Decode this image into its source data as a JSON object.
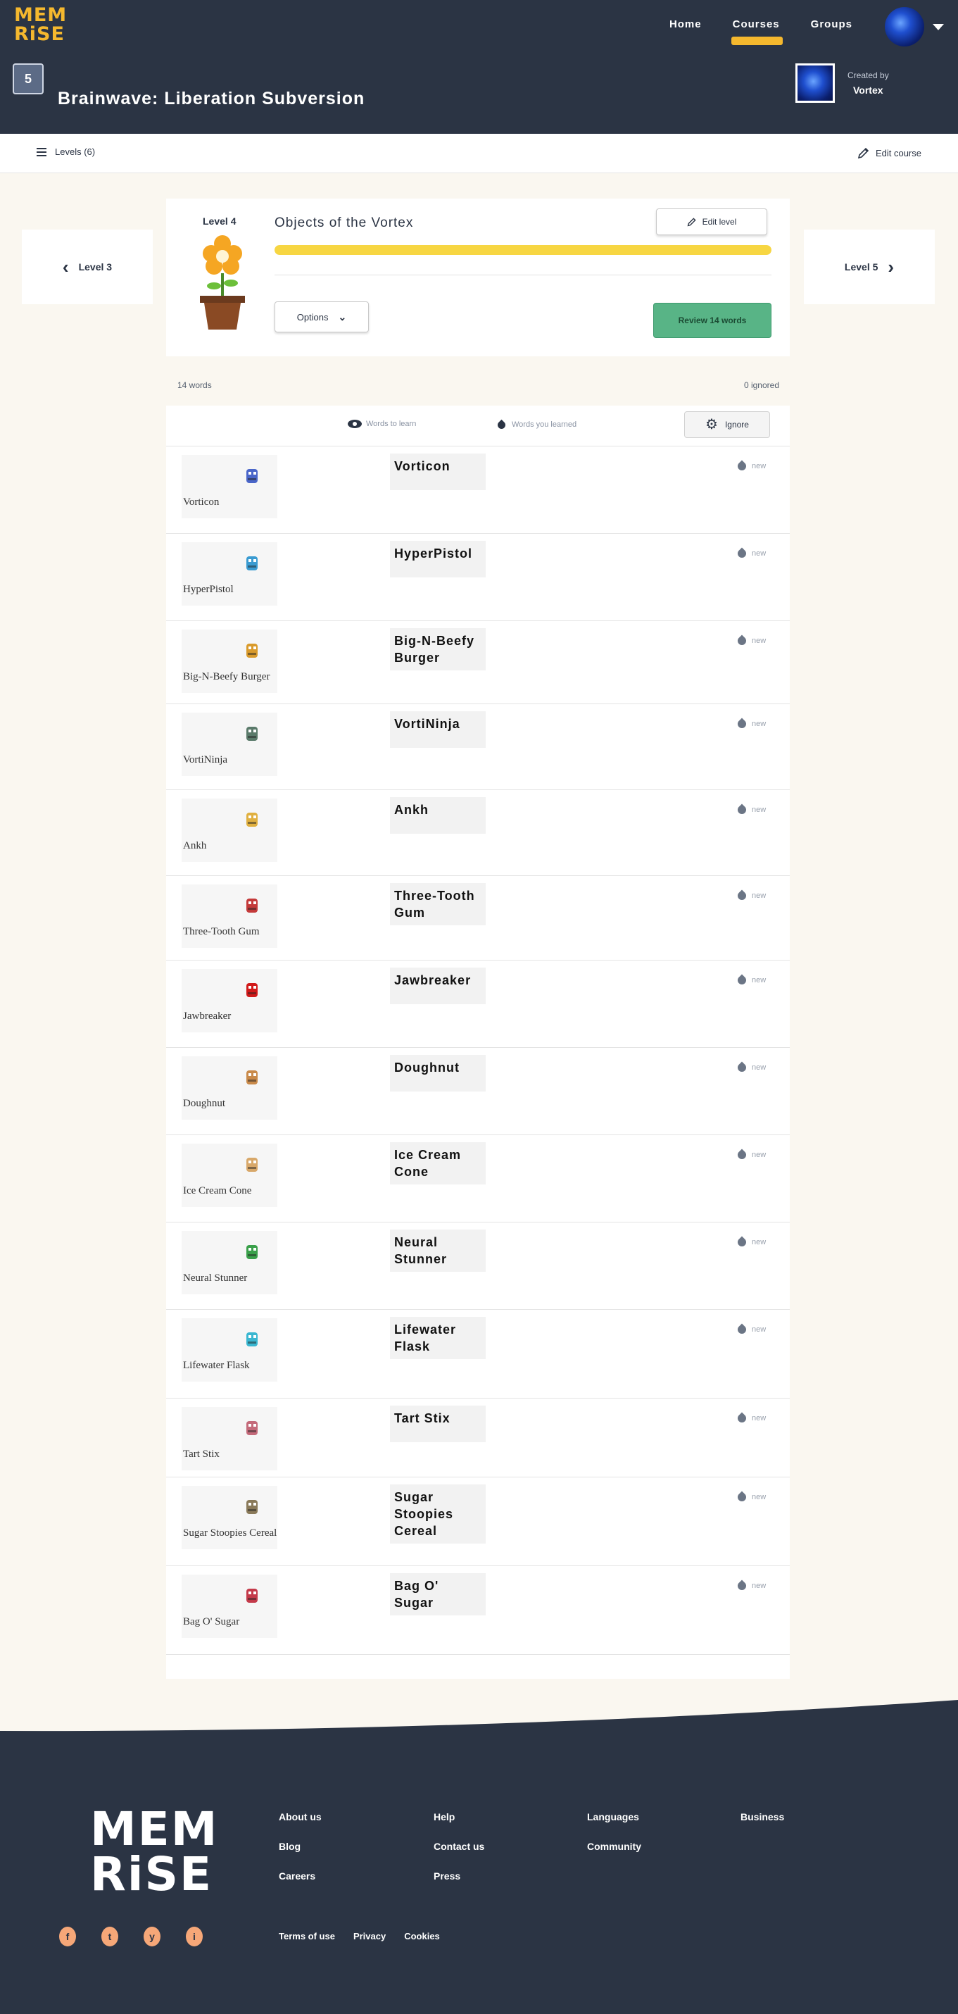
{
  "header": {
    "logo_line1": "MEM",
    "logo_line2": "RiSE",
    "nav": [
      {
        "label": "Home"
      },
      {
        "label": "Courses"
      },
      {
        "label": "Groups"
      }
    ],
    "course_icon_text": "5",
    "course_title": "Brainwave: Liberation Subversion",
    "creator_label": "Created by",
    "creator_name": "Vortex"
  },
  "subbar": {
    "levels_label": "Levels (6)",
    "edit_course_label": "Edit course"
  },
  "level_nav": {
    "prev_label": "Level 3",
    "next_label": "Level 5"
  },
  "level": {
    "number_label": "Level 4",
    "title": "Objects of the Vortex",
    "edit_level_label": "Edit level",
    "progress": 1.0,
    "options_label": "Options",
    "review_label": "Review 14 words"
  },
  "counts": {
    "words": "14 words",
    "ignored": "0 ignored"
  },
  "table": {
    "legend_a": "Words to learn",
    "legend_b": "Words you learned",
    "settings_label": "Ignore",
    "status_label": "new",
    "rows": [
      {
        "label": "Vorticon",
        "definition": "Vorticon",
        "sprite": "vorticon-sprite",
        "color": "#4a66c9"
      },
      {
        "label": "HyperPistol",
        "definition": "HyperPistol",
        "sprite": "pistol-sprite",
        "color": "#3a9bd1"
      },
      {
        "label": "Big-N-Beefy Burger",
        "definition": "Big-N-Beefy Burger",
        "sprite": "burger-sprite",
        "color": "#d99a2b"
      },
      {
        "label": "VortiNinja",
        "definition": "VortiNinja",
        "sprite": "ninja-sprite",
        "color": "#5a7a6a"
      },
      {
        "label": "Ankh",
        "definition": "Ankh",
        "sprite": "ankh-sprite",
        "color": "#e0b040"
      },
      {
        "label": "Three-Tooth Gum",
        "definition": "Three-Tooth Gum",
        "sprite": "gum-sprite",
        "color": "#c43a3a"
      },
      {
        "label": "Jawbreaker",
        "definition": "Jawbreaker",
        "sprite": "jawbreaker-sprite",
        "color": "#d11a1a"
      },
      {
        "label": "Doughnut",
        "definition": "Doughnut",
        "sprite": "doughnut-sprite",
        "color": "#c98a4a"
      },
      {
        "label": "Ice Cream Cone",
        "definition": "Ice Cream Cone",
        "sprite": "icecream-sprite",
        "color": "#d8a86a"
      },
      {
        "label": "Neural Stunner",
        "definition": "Neural Stunner",
        "sprite": "stunner-sprite",
        "color": "#3aa04a"
      },
      {
        "label": "Lifewater Flask",
        "definition": "Lifewater Flask",
        "sprite": "flask-sprite",
        "color": "#3ab7d1"
      },
      {
        "label": "Tart Stix",
        "definition": "Tart Stix",
        "sprite": "stix-sprite",
        "color": "#c46a7a"
      },
      {
        "label": "Sugar Stoopies Cereal",
        "definition": "Sugar Stoopies Cereal",
        "sprite": "cereal-sprite",
        "color": "#8a7a5a"
      },
      {
        "label": "Bag O' Sugar",
        "definition": "Bag O' Sugar",
        "sprite": "sugarbag-sprite",
        "color": "#c43a4a"
      }
    ]
  },
  "footer": {
    "logo_line1": "MEM",
    "logo_line2": "RiSE",
    "col1": [
      "About us",
      "Blog",
      "Careers"
    ],
    "col2": [
      "Help",
      "Contact us",
      "Press"
    ],
    "col3": [
      "Languages",
      "Community"
    ],
    "col4": [
      "Business"
    ],
    "legal": [
      "Terms of use",
      "Privacy",
      "Cookies"
    ],
    "socials": [
      "f",
      "t",
      "y",
      "i"
    ]
  },
  "colors": {
    "header_bg": "#2b3444",
    "brand_yellow": "#f5b82e",
    "review_green": "#58b486",
    "progress_yellow": "#f7d642"
  }
}
